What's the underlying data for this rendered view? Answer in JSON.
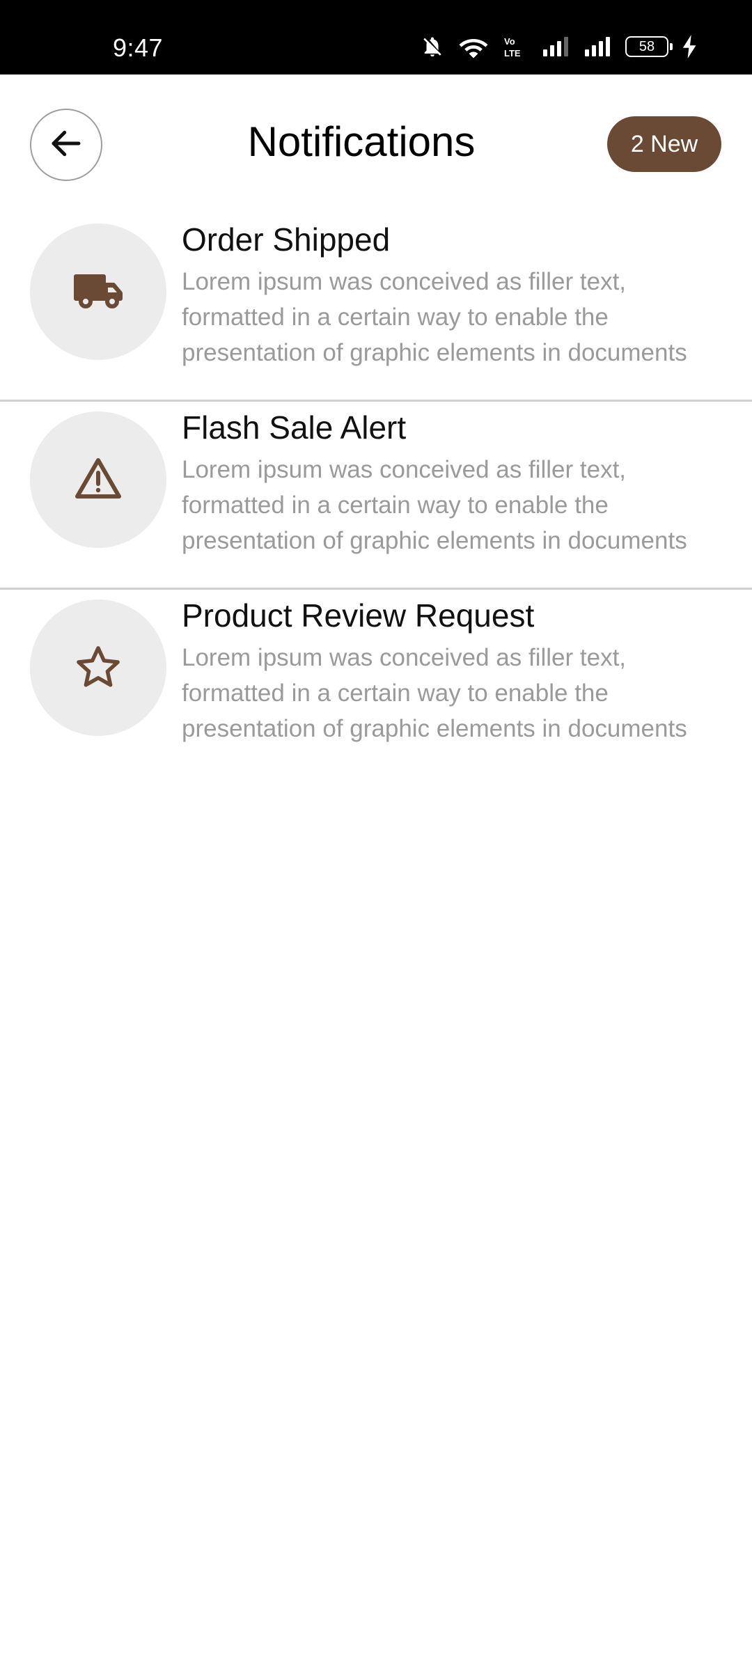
{
  "status_bar": {
    "time": "9:47",
    "battery": "58",
    "icons": [
      "bell-off-icon",
      "wifi-icon",
      "volte-icon",
      "signal-icon",
      "signal-icon",
      "battery-icon",
      "charging-icon"
    ]
  },
  "header": {
    "title": "Notifications",
    "badge": "2 New",
    "back_icon": "arrow-left-icon"
  },
  "colors": {
    "accent": "#6b4a35",
    "icon_bg": "#ececec",
    "body_text": "#9a9a9a",
    "divider": "#d0d0d0"
  },
  "notifications": [
    {
      "icon": "truck-icon",
      "title": "Order Shipped",
      "body": "Lorem ipsum was conceived as filler text, formatted in a certain way to enable the presentation of graphic elements in documents"
    },
    {
      "icon": "warning-icon",
      "title": "Flash Sale Alert",
      "body": "Lorem ipsum was conceived as filler text, formatted in a certain way to enable the presentation of graphic elements in documents"
    },
    {
      "icon": "star-icon",
      "title": "Product Review Request",
      "body": "Lorem ipsum was conceived as filler text, formatted in a certain way to enable the presentation of graphic elements in documents"
    }
  ]
}
